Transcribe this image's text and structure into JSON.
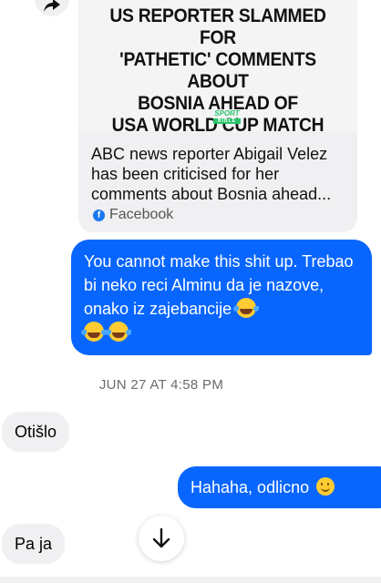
{
  "link_card": {
    "headline": "US REPORTER SLAMMED FOR\n'PATHETIC' COMMENTS ABOUT\nBOSNIA AHEAD OF\nUSA WORLD CUP MATCH",
    "logo_top": "SPORT",
    "logo_bottom": "BIBLE",
    "title": "ABC news reporter Abigail Velez has been criticised for her comments about Bosnia ahead...",
    "source": "Facebook"
  },
  "messages": [
    {
      "direction": "outgoing",
      "text": "You cannot make this shit up. Trebao bi neko reci Alminu da je nazove, onako iz zajebancije",
      "emojis": [
        "joy-emoji",
        "joy-emoji",
        "joy-emoji"
      ]
    },
    {
      "direction": "incoming",
      "text": "Otišlo"
    },
    {
      "direction": "outgoing",
      "text": "Hahaha, odlicno",
      "emojis": [
        "slightly-smiling-emoji"
      ]
    },
    {
      "direction": "incoming",
      "text": "Pa ja"
    }
  ],
  "timestamp": "JUN 27 AT 4:58 PM",
  "colors": {
    "outgoing_bubble": "#0866ff",
    "incoming_bubble": "#f0f0f2",
    "timestamp_text": "#6b6b70",
    "facebook_blue": "#1877f2"
  },
  "icons": {
    "share": "share-arrow-icon",
    "scroll": "arrow-down-icon",
    "source": "facebook-icon"
  }
}
